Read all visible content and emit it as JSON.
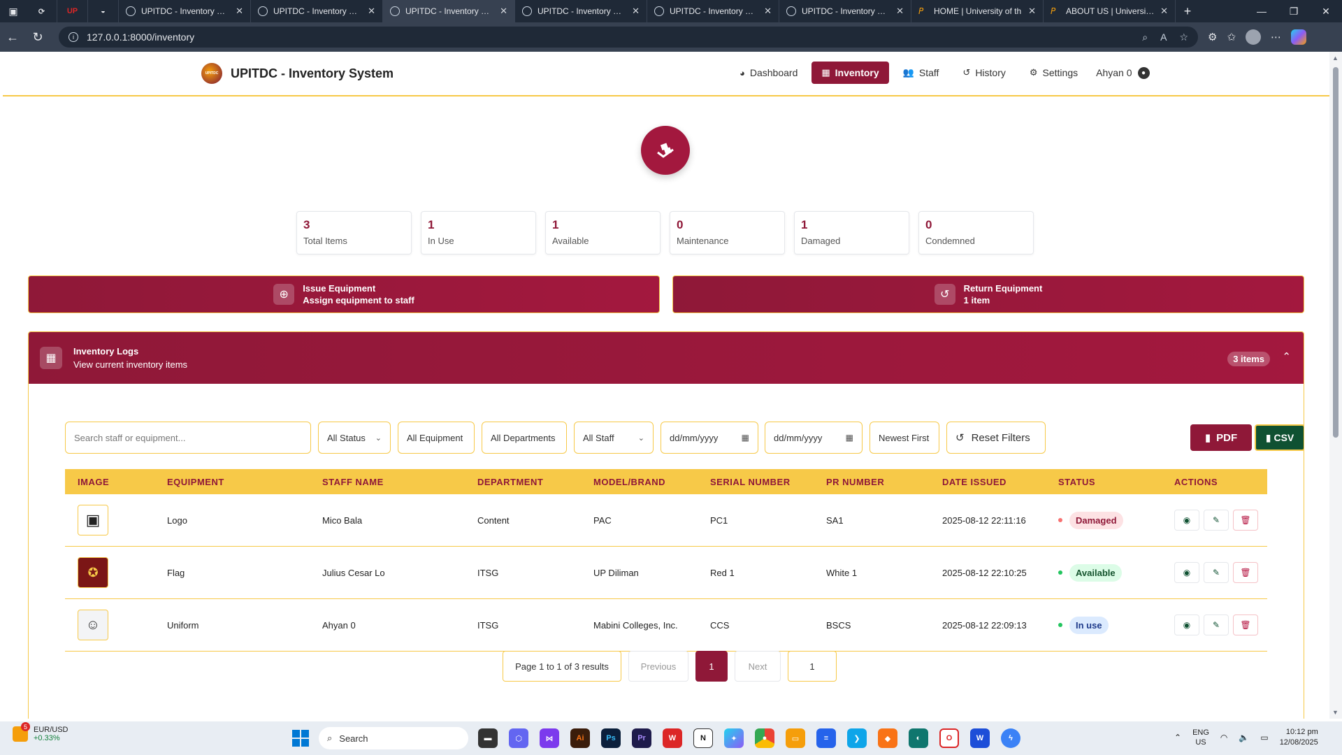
{
  "browser": {
    "tabs": [
      {
        "title": "UPITDC - Inventory Syst",
        "active": false
      },
      {
        "title": "UPITDC - Inventory Syst",
        "active": false
      },
      {
        "title": "UPITDC - Inventory Syst",
        "active": true
      },
      {
        "title": "UPITDC - Inventory Syst",
        "active": false
      },
      {
        "title": "UPITDC - Inventory Syst",
        "active": false
      },
      {
        "title": "UPITDC - Inventory Syst",
        "active": false
      },
      {
        "title": "HOME | University of th",
        "active": false
      },
      {
        "title": "ABOUT US | University o",
        "active": false
      }
    ],
    "pinned_label": "UP",
    "url": "127.0.0.1:8000/inventory"
  },
  "header": {
    "brand_title": "UPITDC - Inventory System",
    "logo_text": "UPITDC",
    "nav": [
      {
        "label": "Dashboard",
        "icon": "dashboard-icon"
      },
      {
        "label": "Inventory",
        "icon": "boxes-icon"
      },
      {
        "label": "Staff",
        "icon": "users-icon"
      },
      {
        "label": "History",
        "icon": "history-icon"
      },
      {
        "label": "Settings",
        "icon": "gear-icon"
      }
    ],
    "user": "Ahyan 0"
  },
  "stats": [
    {
      "value": "3",
      "label": "Total Items"
    },
    {
      "value": "1",
      "label": "In Use"
    },
    {
      "value": "1",
      "label": "Available"
    },
    {
      "value": "0",
      "label": "Maintenance"
    },
    {
      "value": "1",
      "label": "Damaged"
    },
    {
      "value": "0",
      "label": "Condemned"
    }
  ],
  "actions": {
    "issue": {
      "title": "Issue Equipment",
      "subtitle": "Assign equipment to staff"
    },
    "return": {
      "title": "Return Equipment",
      "subtitle": "1 item"
    }
  },
  "logs": {
    "title": "Inventory Logs",
    "subtitle": "View current inventory items",
    "badge": "3 items",
    "filters": {
      "search_placeholder": "Search staff or equipment...",
      "status": "All Status",
      "equipment": "All Equipment",
      "departments": "All Departments",
      "staff": "All Staff",
      "date_from": "dd/mm/yyyy",
      "date_to": "dd/mm/yyyy",
      "sort": "Newest First",
      "reset": "Reset Filters",
      "pdf": "PDF",
      "csv": "CSV"
    },
    "columns": [
      "Image",
      "Equipment",
      "Staff Name",
      "Department",
      "Model/Brand",
      "Serial Number",
      "PR Number",
      "Date Issued",
      "Status",
      "Actions"
    ],
    "rows": [
      {
        "equipment": "Logo",
        "staff": "Mico Bala",
        "department": "Content",
        "model": "PAC",
        "serial": "PC1",
        "pr": "SA1",
        "date": "2025-08-12 22:11:16",
        "status": "Damaged",
        "status_color": "#f87171"
      },
      {
        "equipment": "Flag",
        "staff": "Julius Cesar Lo",
        "department": "ITSG",
        "model": "UP Diliman",
        "serial": "Red 1",
        "pr": "White 1",
        "date": "2025-08-12 22:10:25",
        "status": "Available",
        "status_color": "#22c55e"
      },
      {
        "equipment": "Uniform",
        "staff": "Ahyan 0",
        "department": "ITSG",
        "model": "Mabini Colleges, Inc.",
        "serial": "CCS",
        "pr": "BSCS",
        "date": "2025-08-12 22:09:13",
        "status": "In use",
        "status_color": "#22c55e"
      }
    ],
    "pagination": {
      "summary": "Page 1 to 1 of 3 results",
      "previous": "Previous",
      "current": "1",
      "next": "Next",
      "goto": "1"
    }
  },
  "taskbar": {
    "ticker_name": "EUR/USD",
    "ticker_change": "+0.33%",
    "ticker_badge": "5",
    "search": "Search",
    "lang1": "ENG",
    "lang2": "US",
    "time": "10:12 pm",
    "date": "12/08/2025"
  },
  "colors": {
    "primary": "#8f1838",
    "accent": "#f7c948",
    "csv": "#0f5132"
  }
}
